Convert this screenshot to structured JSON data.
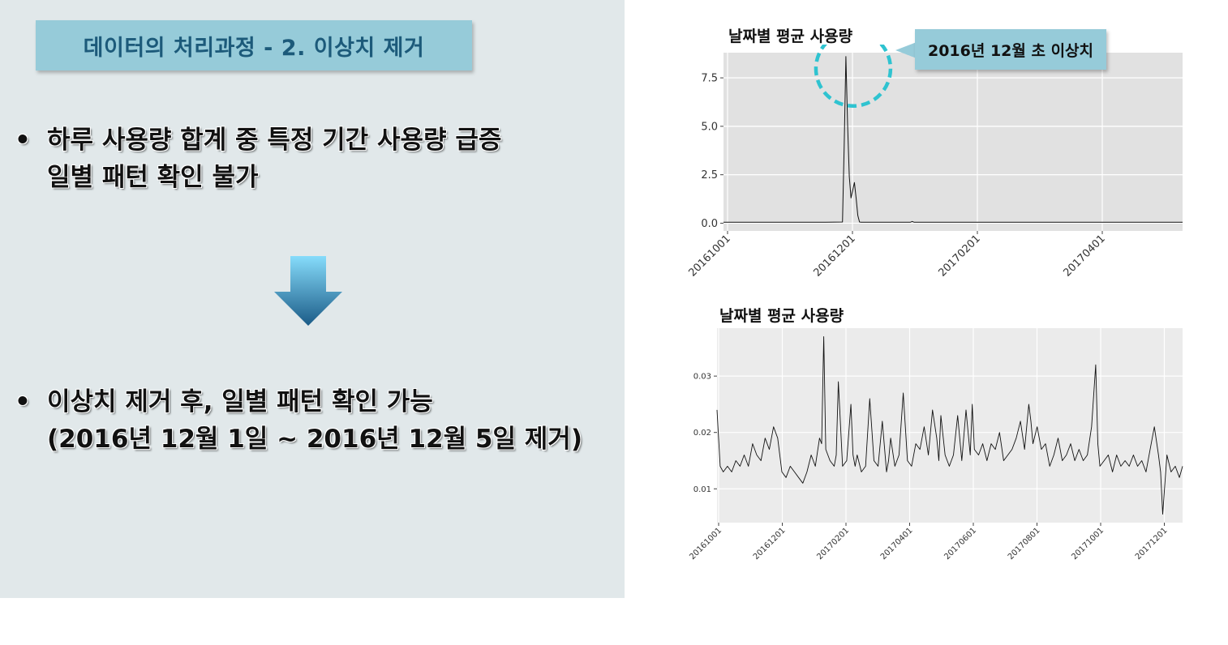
{
  "slide": {
    "title": "데이터의 처리과정 - 2. 이상치 제거",
    "bullet_1": {
      "marker": "•",
      "line_1": "하루 사용량 합계 중 특정 기간 사용량 급증",
      "line_2": "일별 패턴 확인 불가"
    },
    "bullet_2": {
      "marker": "•",
      "line_1": "이상치 제거 후, 일별 패턴 확인 가능",
      "line_2": "(2016년 12월 1일 ~ 2016년 12월 5일 제거)"
    },
    "arrow_icon": "down-arrow-icon",
    "colors": {
      "panel_bg": "#e1e8ea",
      "title_bg": "#96cbd9",
      "title_text": "#1c5a7a",
      "callout_bg": "#96cbd9",
      "highlight_circle": "#2fc3d0"
    }
  },
  "callout": {
    "text": "2016년 12월 초 이상치"
  },
  "chart_data": [
    {
      "type": "line",
      "title": "날짜별 평균 사용량",
      "xlabel": "",
      "ylabel": "",
      "x_tick_labels": [
        "20161001",
        "20161201",
        "20170201",
        "20170401"
      ],
      "y_tick_labels": [
        "0.0",
        "2.5",
        "5.0",
        "7.5"
      ],
      "ylim": [
        -0.4,
        8.8
      ],
      "xlim_day_index": [
        0,
        270
      ],
      "grid": true,
      "x_day_index": [
        0,
        10,
        20,
        30,
        40,
        55,
        60,
        70,
        71,
        72,
        73,
        74,
        75,
        76,
        77,
        78,
        79,
        80,
        81,
        82,
        85,
        90,
        100,
        110,
        111,
        112,
        120,
        150,
        180,
        210,
        240,
        270
      ],
      "values": [
        0.05,
        0.05,
        0.05,
        0.05,
        0.05,
        0.05,
        0.05,
        0.06,
        4.0,
        8.6,
        5.1,
        2.4,
        1.3,
        1.7,
        2.1,
        1.3,
        0.4,
        0.06,
        0.05,
        0.05,
        0.05,
        0.05,
        0.05,
        0.05,
        0.09,
        0.05,
        0.05,
        0.05,
        0.05,
        0.05,
        0.05,
        0.05
      ]
    },
    {
      "type": "line",
      "title": "날짜별 평균 사용량",
      "xlabel": "",
      "ylabel": "",
      "x_tick_labels": [
        "20161001",
        "20161201",
        "20170201",
        "20170401",
        "20170601",
        "20170801",
        "20171001",
        "20171201"
      ],
      "y_tick_labels": [
        "0.01",
        "0.02",
        "0.03"
      ],
      "ylim": [
        0.004,
        0.0385
      ],
      "xlim_day_index": [
        0,
        445
      ],
      "grid": true,
      "x_day_index": [
        0,
        3,
        6,
        10,
        14,
        18,
        22,
        26,
        30,
        34,
        38,
        42,
        46,
        50,
        54,
        58,
        62,
        66,
        70,
        74,
        78,
        82,
        86,
        90,
        94,
        98,
        100,
        102,
        104,
        108,
        112,
        114,
        116,
        120,
        124,
        128,
        130,
        132,
        134,
        138,
        142,
        146,
        150,
        154,
        158,
        162,
        164,
        166,
        170,
        174,
        178,
        182,
        186,
        190,
        194,
        198,
        202,
        206,
        210,
        212,
        214,
        218,
        222,
        226,
        230,
        234,
        238,
        242,
        244,
        246,
        250,
        254,
        258,
        262,
        266,
        270,
        274,
        278,
        282,
        286,
        290,
        294,
        298,
        300,
        302,
        306,
        310,
        314,
        318,
        322,
        326,
        330,
        334,
        338,
        342,
        346,
        350,
        354,
        358,
        362,
        364,
        366,
        370,
        374,
        378,
        382,
        386,
        390,
        394,
        398,
        402,
        406,
        410,
        414,
        418,
        422,
        424,
        426,
        430,
        434,
        438,
        442,
        445
      ],
      "values": [
        0.024,
        0.014,
        0.013,
        0.014,
        0.013,
        0.015,
        0.014,
        0.016,
        0.014,
        0.018,
        0.016,
        0.015,
        0.019,
        0.017,
        0.021,
        0.019,
        0.013,
        0.012,
        0.014,
        0.013,
        0.012,
        0.011,
        0.013,
        0.016,
        0.014,
        0.019,
        0.018,
        0.037,
        0.017,
        0.015,
        0.014,
        0.016,
        0.029,
        0.014,
        0.015,
        0.025,
        0.016,
        0.014,
        0.016,
        0.013,
        0.014,
        0.026,
        0.015,
        0.014,
        0.022,
        0.013,
        0.015,
        0.019,
        0.014,
        0.016,
        0.027,
        0.015,
        0.014,
        0.018,
        0.017,
        0.021,
        0.016,
        0.024,
        0.019,
        0.015,
        0.023,
        0.016,
        0.014,
        0.016,
        0.023,
        0.015,
        0.024,
        0.016,
        0.025,
        0.017,
        0.016,
        0.018,
        0.015,
        0.018,
        0.017,
        0.02,
        0.015,
        0.016,
        0.017,
        0.019,
        0.022,
        0.017,
        0.025,
        0.022,
        0.018,
        0.021,
        0.017,
        0.018,
        0.014,
        0.016,
        0.019,
        0.015,
        0.016,
        0.018,
        0.015,
        0.017,
        0.015,
        0.016,
        0.021,
        0.032,
        0.018,
        0.014,
        0.015,
        0.016,
        0.013,
        0.016,
        0.014,
        0.015,
        0.014,
        0.016,
        0.014,
        0.015,
        0.013,
        0.017,
        0.021,
        0.016,
        0.013,
        0.0055,
        0.016,
        0.013,
        0.014,
        0.012,
        0.014
      ]
    }
  ]
}
